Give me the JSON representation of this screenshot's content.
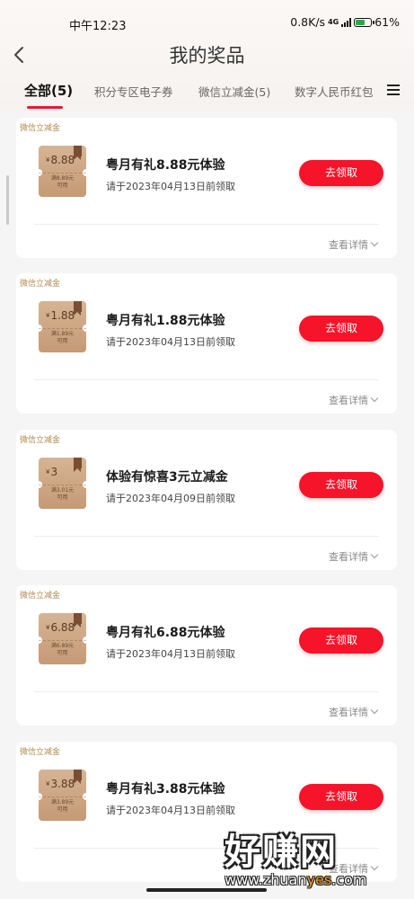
{
  "status_bar": {
    "time": "中午12:23",
    "net_speed": "0.8K/s",
    "network": "4G",
    "battery": "61%",
    "battery_level": 0.61
  },
  "header": {
    "title": "我的奖品",
    "back_icon": "chevron-left-icon"
  },
  "tabs": [
    {
      "label": "全部(5)",
      "active": true
    },
    {
      "label": "积分专区电子券",
      "active": false
    },
    {
      "label": "微信立减金(5)",
      "active": false
    },
    {
      "label": "数字人民币红包",
      "active": false
    }
  ],
  "tab_menu_icon": "list-menu-icon",
  "cards": [
    {
      "label": "微信立减金",
      "voucher_currency": "¥",
      "voucher_amount": "8.88",
      "voucher_condition": "满8.89元",
      "voucher_usage": "可用",
      "title": "粤月有礼8.88元体验",
      "deadline": "请于2023年04月13日前领取",
      "button": "去领取",
      "details": "查看详情"
    },
    {
      "label": "微信立减金",
      "voucher_currency": "¥",
      "voucher_amount": "1.88",
      "voucher_condition": "满1.89元",
      "voucher_usage": "可用",
      "title": "粤月有礼1.88元体验",
      "deadline": "请于2023年04月13日前领取",
      "button": "去领取",
      "details": "查看详情"
    },
    {
      "label": "微信立减金",
      "voucher_currency": "¥",
      "voucher_amount": "3",
      "voucher_condition": "满3.01元",
      "voucher_usage": "可用",
      "title": "体验有惊喜3元立减金",
      "deadline": "请于2023年04月09日前领取",
      "button": "去领取",
      "details": "查看详情"
    },
    {
      "label": "微信立减金",
      "voucher_currency": "¥",
      "voucher_amount": "6.88",
      "voucher_condition": "满6.89元",
      "voucher_usage": "可用",
      "title": "粤月有礼6.88元体验",
      "deadline": "请于2023年04月13日前领取",
      "button": "去领取",
      "details": "查看详情"
    },
    {
      "label": "微信立减金",
      "voucher_currency": "¥",
      "voucher_amount": "3.88",
      "voucher_condition": "满3.89元",
      "voucher_usage": "可用",
      "title": "粤月有礼3.88元体验",
      "deadline": "请于2023年04月13日前领取",
      "button": "去领取",
      "details": "查看详情"
    }
  ],
  "watermark": {
    "logo_text": "好赚网",
    "url_prefix": "www.zhuan",
    "url_highlight": "yes",
    "url_suffix": ".com"
  },
  "colors": {
    "accent": "#e8192c",
    "button": "#f5142a",
    "voucher": "#c59a75",
    "label": "#b08a52"
  }
}
